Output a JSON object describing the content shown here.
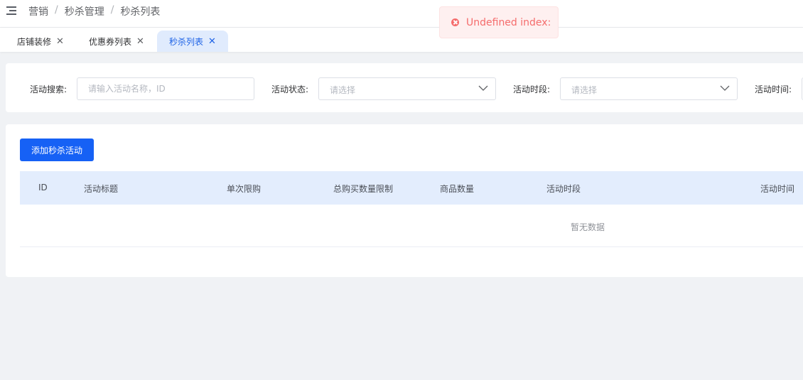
{
  "breadcrumb": [
    "营销",
    "秒杀管理",
    "秒杀列表"
  ],
  "breadcrumb_separator": "/",
  "tabs": [
    {
      "label": "店铺装修",
      "active": false
    },
    {
      "label": "优惠券列表",
      "active": false
    },
    {
      "label": "秒杀列表",
      "active": true
    }
  ],
  "tab_close_glyph": "✕",
  "filters": {
    "search_label": "活动搜索:",
    "search_placeholder": "请输入活动名称，ID",
    "status_label": "活动状态:",
    "status_placeholder": "请选择",
    "period_label": "活动时段:",
    "period_placeholder": "请选择",
    "time_label": "活动时间:"
  },
  "add_button": "添加秒杀活动",
  "table": {
    "columns": [
      "ID",
      "活动标题",
      "单次限购",
      "总购买数量限制",
      "商品数量",
      "活动时段",
      "活动时间"
    ],
    "empty_text": "暂无数据"
  },
  "toast": {
    "message": "Undefined index:",
    "type": "error"
  },
  "colors": {
    "primary": "#1661f5",
    "error": "#f56c6c",
    "header_bg": "#e3edfd"
  }
}
